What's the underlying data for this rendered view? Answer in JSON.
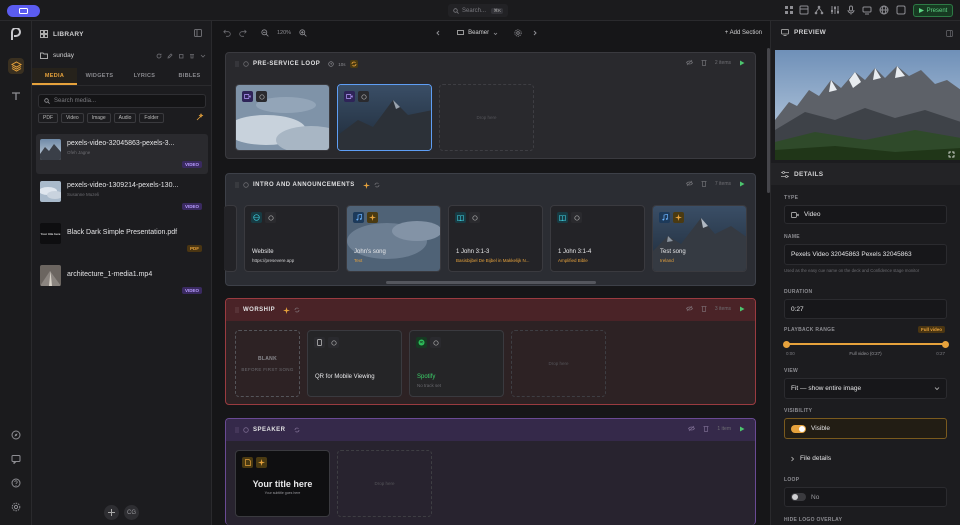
{
  "topbar": {
    "search_placeholder": "Search...",
    "search_kbd": "⌘K",
    "present_label": "Present"
  },
  "colors": {
    "accent": "#e6a23c",
    "present": "#5fd585",
    "brand": "#5b5cf0"
  },
  "library": {
    "title": "LIBRARY",
    "folder": "sunday",
    "tabs": [
      "MEDIA",
      "WIDGETS",
      "LYRICS",
      "BIBLES"
    ],
    "active_tab": "MEDIA",
    "search_placeholder": "Search media...",
    "filters": [
      "PDF",
      "Video",
      "Image",
      "Audio",
      "Folder"
    ],
    "items": [
      {
        "name": "pexels-video-32045863-pexels-3...",
        "sub": "Ofeh Jagne",
        "badge": "VIDEO",
        "kind": "video"
      },
      {
        "name": "pexels-video-1309214-pexels-130...",
        "sub": "Susanne Muzeli",
        "badge": "VIDEO",
        "kind": "video"
      },
      {
        "name": "Black Dark Simple Presentation.pdf",
        "sub": "",
        "badge": "PDF",
        "kind": "pdf",
        "thumb_text": "Your title here"
      },
      {
        "name": "architecture_1-media1.mp4",
        "sub": "",
        "badge": "VIDEO",
        "kind": "video"
      }
    ],
    "footer_toggle": "CG"
  },
  "canvas": {
    "zoom": "120%",
    "screen": "Beamer",
    "add_section": "Add Section",
    "sections": [
      {
        "title": "PRE-SERVICE LOOP",
        "meta": "10s",
        "count": "2 items"
      },
      {
        "title": "INTRO AND ANNOUNCEMENTS",
        "count": "7 items"
      },
      {
        "title": "WORSHIP",
        "count": "3 items"
      },
      {
        "title": "SPEAKER",
        "count": "1 item"
      }
    ],
    "intro_cards": [
      {
        "title": "Website",
        "sub": "https://presevere.app"
      },
      {
        "title": "John's song",
        "sub": "Text"
      },
      {
        "title": "1 John 3:1-3",
        "sub": "Basisbijbel De Bijbel in Makkelijk N..."
      },
      {
        "title": "1 John 3:1-4",
        "sub": "Amplified Bible"
      },
      {
        "title": "Test song",
        "sub": "Ireland"
      }
    ],
    "worship_cards": [
      {
        "title": "BLANK",
        "sub": "BEFORE FIRST SONG"
      },
      {
        "title": "QR for Mobile Viewing",
        "sub": ""
      },
      {
        "title": "Spotify",
        "sub": "No track set"
      }
    ],
    "drop_label": "Drop here",
    "speaker_card": {
      "title": "Your title here",
      "sub": "Your subtitle goes here"
    }
  },
  "preview": {
    "title": "PREVIEW",
    "details_title": "DETAILS",
    "type_label": "TYPE",
    "type_value": "Video",
    "name_label": "NAME",
    "name_value": "Pexels Video 32045863 Pexels 32045863",
    "name_help": "Used as the easy cue name on the deck and Confidence stage monitor",
    "duration_label": "DURATION",
    "duration_value": "0:27",
    "playback_label": "PLAYBACK RANGE",
    "playback_badge": "Full video",
    "range_start": "0:00",
    "range_mid": "Full video (0:27)",
    "range_end": "0:27",
    "range_fraction_start": 0,
    "range_fraction_end": 1,
    "view_label": "VIEW",
    "view_value": "Fit — show entire image",
    "visibility_label": "VISIBILITY",
    "visibility_value": "Visible",
    "file_details": "File details",
    "loop_label": "LOOP",
    "loop_value": "No",
    "hide_logo_label": "HIDE LOGO OVERLAY"
  }
}
